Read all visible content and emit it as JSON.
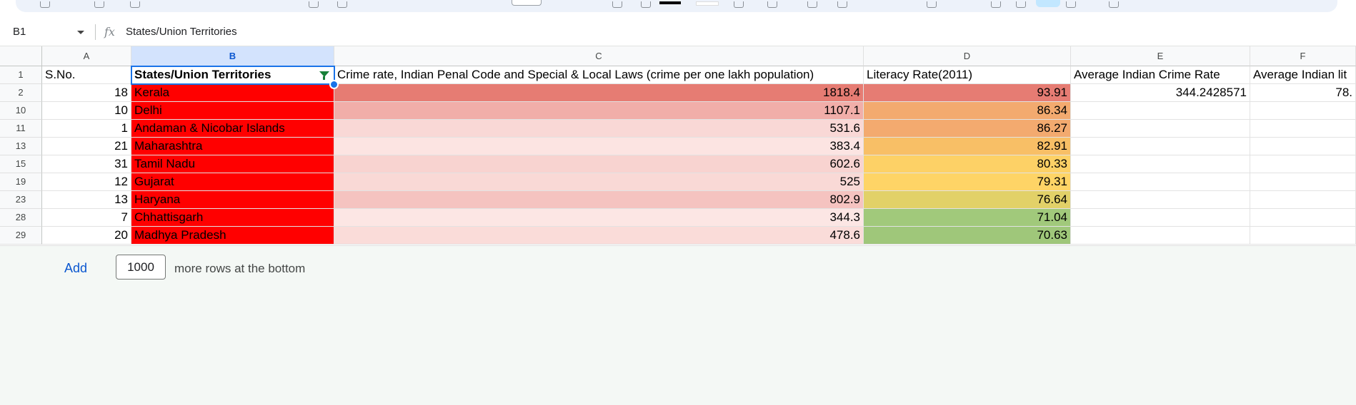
{
  "formula_bar": {
    "cell_ref": "B1",
    "fx_label": "fx",
    "content": "States/Union Territories"
  },
  "columns": [
    "A",
    "B",
    "C",
    "D",
    "E",
    "F"
  ],
  "header_row": {
    "row_number": "1",
    "A": "S.No.",
    "B": "States/Union Territories",
    "C": "Crime rate, Indian Penal Code and Special & Local Laws (crime per one lakh population)",
    "D": "Literacy Rate(2011)",
    "E": "Average Indian Crime Rate",
    "F": "Average Indian lit"
  },
  "rows": [
    {
      "row_number": "2",
      "sno": "18",
      "state": "Kerala",
      "crime": "1818.4",
      "literacy": "93.91",
      "avg_crime": "344.2428571",
      "avg_lit": "78.",
      "crime_color": "#e67c73",
      "lit_color": "#e67c73"
    },
    {
      "row_number": "10",
      "sno": "10",
      "state": "Delhi",
      "crime": "1107.1",
      "literacy": "86.34",
      "avg_crime": "",
      "avg_lit": "",
      "crime_color": "#f1aea9",
      "lit_color": "#f3aa6f"
    },
    {
      "row_number": "11",
      "sno": "1",
      "state": "Andaman & Nicobar Islands",
      "crime": "531.6",
      "literacy": "86.27",
      "avg_crime": "",
      "avg_lit": "",
      "crime_color": "#f9d8d6",
      "lit_color": "#f3aa6f"
    },
    {
      "row_number": "13",
      "sno": "21",
      "state": "Maharashtra",
      "crime": "383.4",
      "literacy": "82.91",
      "avg_crime": "",
      "avg_lit": "",
      "crime_color": "#fce4e2",
      "lit_color": "#f8bf66"
    },
    {
      "row_number": "15",
      "sno": "31",
      "state": "Tamil Nadu",
      "crime": "602.6",
      "literacy": "80.33",
      "avg_crime": "",
      "avg_lit": "",
      "crime_color": "#f8d3d0",
      "lit_color": "#fdd166"
    },
    {
      "row_number": "19",
      "sno": "12",
      "state": "Gujarat",
      "crime": "525",
      "literacy": "79.31",
      "avg_crime": "",
      "avg_lit": "",
      "crime_color": "#f9d9d6",
      "lit_color": "#fed466"
    },
    {
      "row_number": "23",
      "sno": "13",
      "state": "Haryana",
      "crime": "802.9",
      "literacy": "76.64",
      "avg_crime": "",
      "avg_lit": "",
      "crime_color": "#f5c3c0",
      "lit_color": "#e2d168"
    },
    {
      "row_number": "28",
      "sno": "7",
      "state": "Chhattisgarh",
      "crime": "344.3",
      "literacy": "71.04",
      "avg_crime": "",
      "avg_lit": "",
      "crime_color": "#fce6e4",
      "lit_color": "#a1c97b"
    },
    {
      "row_number": "29",
      "sno": "20",
      "state": "Madhya Pradesh",
      "crime": "478.6",
      "literacy": "70.63",
      "avg_crime": "",
      "avg_lit": "",
      "crime_color": "#fadcd9",
      "lit_color": "#9fc77a"
    }
  ],
  "footer": {
    "add_label": "Add",
    "rows_value": "1000",
    "more_rows_text": "more rows at the bottom"
  },
  "colors": {
    "state_fill": "#ff0000",
    "selection": "#1a73e8",
    "filter_icon": "#188038"
  }
}
